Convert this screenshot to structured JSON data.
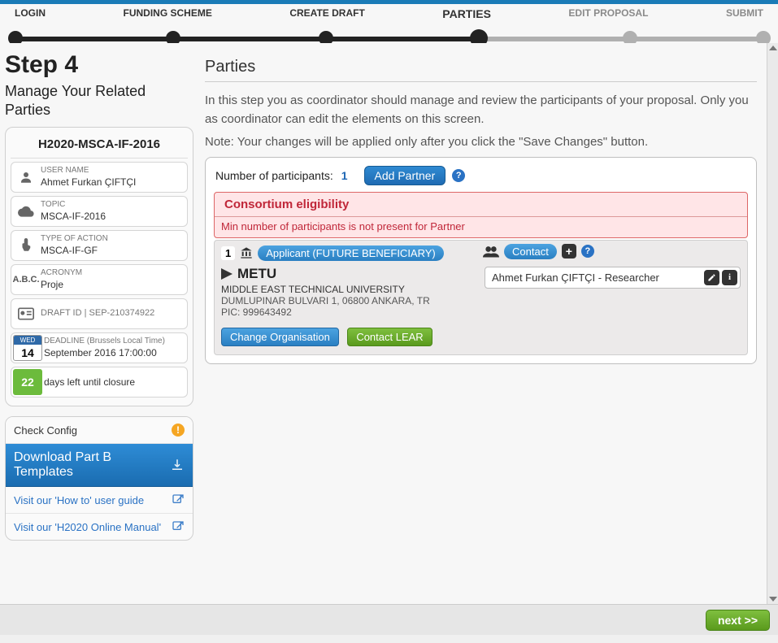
{
  "progress": {
    "steps": [
      "LOGIN",
      "FUNDING SCHEME",
      "CREATE DRAFT",
      "PARTIES",
      "EDIT PROPOSAL",
      "SUBMIT"
    ],
    "active_index": 3
  },
  "left": {
    "step_title": "Step 4",
    "step_subtitle": "Manage Your Related Parties",
    "call_code": "H2020-MSCA-IF-2016",
    "username_label": "USER NAME",
    "username_value": "Ahmet Furkan ÇIFTÇI",
    "topic_label": "TOPIC",
    "topic_value": "MSCA-IF-2016",
    "action_label": "TYPE OF ACTION",
    "action_value": "MSCA-IF-GF",
    "acronym_label": "ACRONYM",
    "acronym_value": "Proje",
    "draft_label": "DRAFT ID",
    "draft_value": "SEP-210374922",
    "deadline_label": "DEADLINE (Brussels Local Time)",
    "deadline_value": "September 2016 17:00:00",
    "cal_day_name": "WED",
    "cal_day_num": "14",
    "days_left_num": "22",
    "days_left_text": "days left until closure",
    "check_config": "Check Config",
    "download_templates": "Download Part B Templates",
    "howto": "Visit our 'How to' user guide",
    "manual": "Visit our 'H2020 Online Manual'"
  },
  "main": {
    "heading": "Parties",
    "para1": "In this step you as coordinator should manage and review the participants of your proposal. Only you as coordinator can edit the elements on this screen.",
    "para2": "Note: Your changes will be applied only after you click the \"Save Changes\" button.",
    "participants_label": "Number of participants:",
    "participants_count": "1",
    "add_partner": "Add Partner",
    "alert_title": "Consortium eligibility",
    "alert_msg": "Min number of participants is not present for Partner",
    "party": {
      "index": "1",
      "role": "Applicant (FUTURE BENEFICIARY)",
      "contact_label": "Contact",
      "org_short": "METU",
      "org_full": "MIDDLE EAST TECHNICAL UNIVERSITY",
      "org_addr": "DUMLUPINAR BULVARI 1, 06800 ANKARA, TR",
      "org_pic": "PIC: 999643492",
      "change_org": "Change Organisation",
      "contact_lear": "Contact LEAR",
      "contact_person": "Ahmet Furkan ÇIFTÇI - Researcher"
    }
  },
  "footer": {
    "next": "next >>"
  }
}
